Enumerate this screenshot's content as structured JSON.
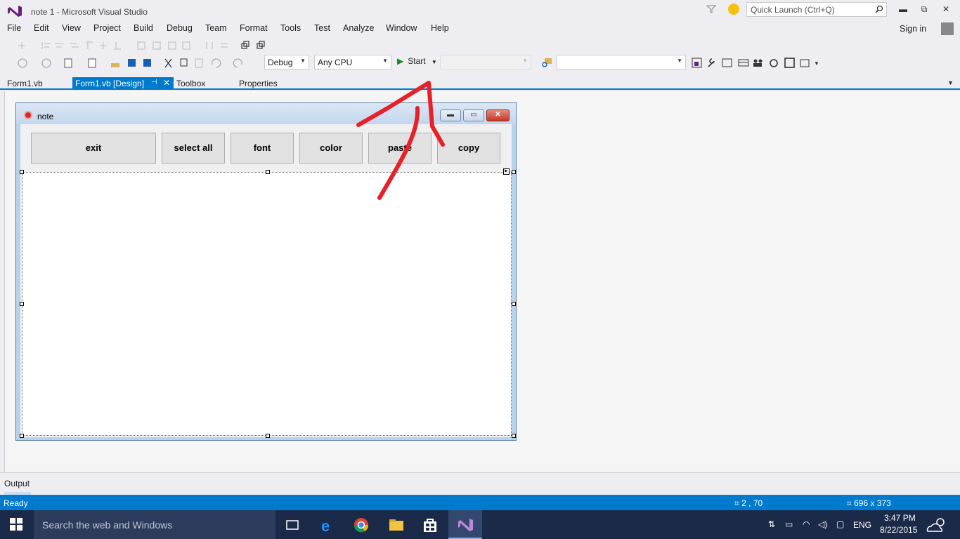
{
  "window": {
    "title": "note 1 - Microsoft Visual Studio"
  },
  "quick_launch": {
    "placeholder": "Quick Launch (Ctrl+Q)"
  },
  "menu": [
    "File",
    "Edit",
    "View",
    "Project",
    "Build",
    "Debug",
    "Team",
    "Format",
    "Tools",
    "Test",
    "Analyze",
    "Window",
    "Help"
  ],
  "account": {
    "signin_label": "Sign in"
  },
  "toolbar": {
    "configuration": "Debug",
    "platform": "Any CPU",
    "start_label": "Start",
    "target_value": "",
    "find_value": ""
  },
  "tabs": [
    {
      "label": "Form1.vb"
    },
    {
      "label": "Form1.vb [Design]",
      "pin": "⊣",
      "close": "✕"
    },
    {
      "label": "Toolbox"
    },
    {
      "label": "Properties"
    }
  ],
  "form": {
    "title": "note",
    "buttons": [
      "exit",
      "select all",
      "font",
      "color",
      "paste",
      "copy"
    ],
    "controls": {
      "minimize": "▬",
      "maximize": "▭",
      "close": "✕"
    }
  },
  "output": {
    "label": "Output"
  },
  "status": {
    "ready": "Ready",
    "position": "2 , 70",
    "size": "696 x 373"
  },
  "taskbar": {
    "search_placeholder": "Search the web and Windows",
    "language": "ENG",
    "time": "3:47 PM",
    "date": "8/22/2015"
  },
  "colors": {
    "accent": "#007acc",
    "annotation": "#e8202a",
    "vs_purple": "#68217a"
  },
  "icons": [
    "vs-logo-icon",
    "filter-icon",
    "feedback-smiley-icon",
    "search-icon",
    "minimize-icon",
    "restore-icon",
    "close-icon",
    "start-play-icon",
    "windows-start-icon",
    "task-view-icon",
    "edge-icon",
    "chrome-icon",
    "file-explorer-icon",
    "store-icon",
    "visual-studio-icon",
    "weather-icon"
  ]
}
